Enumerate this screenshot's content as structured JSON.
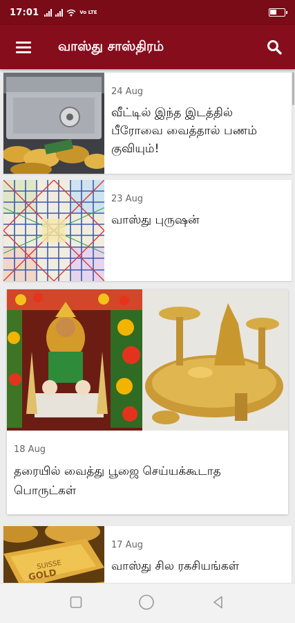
{
  "status_bar": {
    "time": "17:01",
    "volte": "Vo LTE",
    "battery_level": 0.45
  },
  "app_bar": {
    "title": "வாஸ்து சாஸ்திரம்",
    "menu_icon": "hamburger-menu-icon",
    "search_icon": "search-icon"
  },
  "articles": [
    {
      "date": "24 Aug",
      "title": "வீட்டில் இந்த இடத்தில் பீரோவை வைத்தால் பணம் குவியும்!",
      "image": "safe-with-gold-coins"
    },
    {
      "date": "23 Aug",
      "title": "வாஸ்து புருஷன்",
      "image": "vastu-grid-diagram"
    },
    {
      "date": "18 Aug",
      "title": "தரையில் வைத்து பூஜை செய்யக்கூடாத பொருட்கள்",
      "image": "pooja-altar-and-brass-items"
    },
    {
      "date": "17 Aug",
      "title": "வாஸ்து சில ரகசியங்கள்",
      "image": "gold-bars"
    }
  ],
  "nav": {
    "back_icon": "back-triangle-icon",
    "home_icon": "home-circle-icon",
    "recents_icon": "recents-square-icon"
  }
}
